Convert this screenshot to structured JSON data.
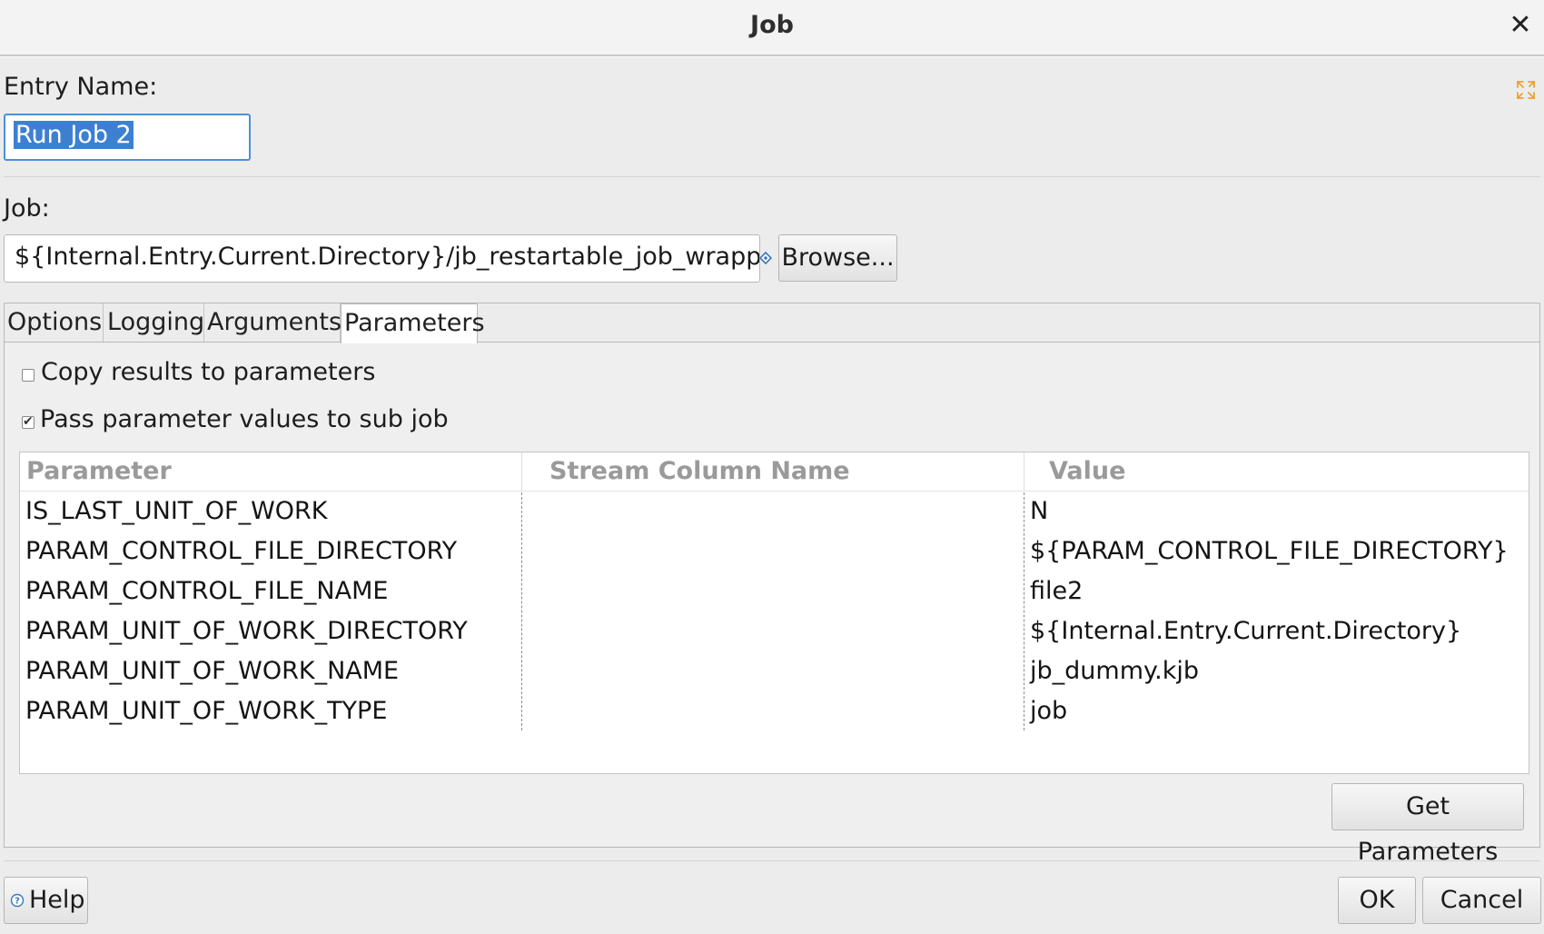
{
  "window": {
    "title": "Job",
    "close_icon": "close-icon"
  },
  "entry": {
    "label": "Entry Name:",
    "value": "Run Job 2"
  },
  "job": {
    "label": "Job:",
    "value": "${Internal.Entry.Current.Directory}/jb_restartable_job_wrapper.",
    "browse_label": "Browse..."
  },
  "tabs": [
    {
      "label": "Options",
      "active": false
    },
    {
      "label": "Logging",
      "active": false
    },
    {
      "label": "Arguments",
      "active": false
    },
    {
      "label": "Parameters",
      "active": true
    }
  ],
  "parameters_tab": {
    "copy_results": {
      "label": "Copy results to parameters",
      "checked": false
    },
    "pass_values": {
      "label": "Pass parameter values to sub job",
      "checked": true
    },
    "table": {
      "headers": [
        "Parameter",
        "Stream Column Name",
        "Value"
      ],
      "rows": [
        [
          "IS_LAST_UNIT_OF_WORK",
          "",
          "N"
        ],
        [
          "PARAM_CONTROL_FILE_DIRECTORY",
          "",
          "${PARAM_CONTROL_FILE_DIRECTORY}"
        ],
        [
          "PARAM_CONTROL_FILE_NAME",
          "",
          "file2"
        ],
        [
          "PARAM_UNIT_OF_WORK_DIRECTORY",
          "",
          "${Internal.Entry.Current.Directory}"
        ],
        [
          "PARAM_UNIT_OF_WORK_NAME",
          "",
          "jb_dummy.kjb"
        ],
        [
          "PARAM_UNIT_OF_WORK_TYPE",
          "",
          "job"
        ]
      ]
    },
    "get_parameters_label": "Get Parameters"
  },
  "footer": {
    "help_label": "Help",
    "ok_label": "OK",
    "cancel_label": "Cancel"
  },
  "colors": {
    "selection": "#3d80d2",
    "focus_border": "#4a90d9",
    "expand_icon": "#f0a030"
  }
}
